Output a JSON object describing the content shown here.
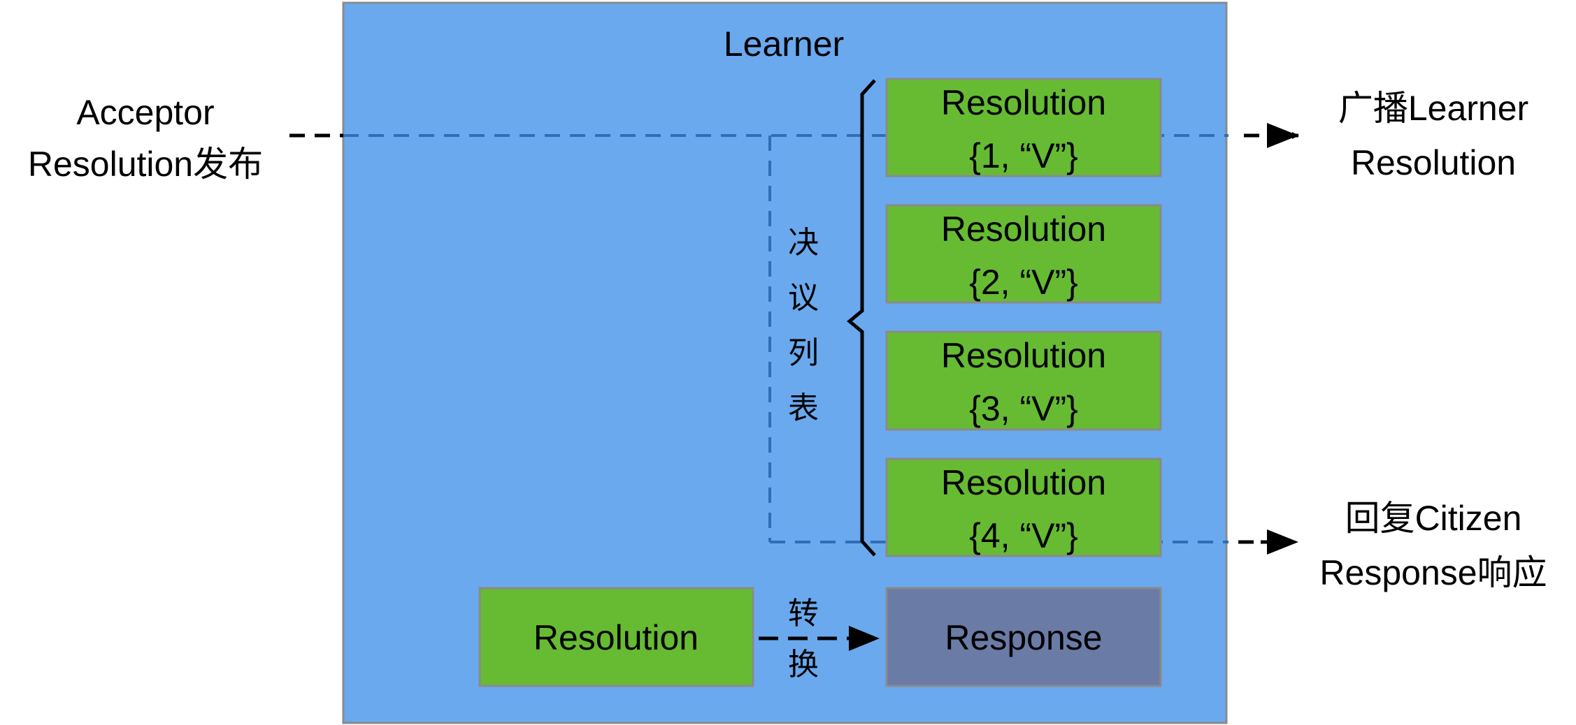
{
  "colors": {
    "learner_bg": "#6AA9EE",
    "resolution_bg": "#66BB33",
    "response_bg": "#6A7BA5",
    "dashed_line": "#2F6DB5",
    "border": "#8A8A8A"
  },
  "learner": {
    "title": "Learner"
  },
  "left_input": {
    "line1": "Acceptor",
    "line2": "Resolution发布"
  },
  "right_top_output": {
    "line1": "广播Learner",
    "line2": "Resolution"
  },
  "right_bottom_output": {
    "line1": "回复Citizen",
    "line2": "Response响应"
  },
  "resolution_list": {
    "label_chars": [
      "决",
      "议",
      "列",
      "表"
    ],
    "items": [
      {
        "title": "Resolution",
        "value": "{1, “V”}"
      },
      {
        "title": "Resolution",
        "value": "{2, “V”}"
      },
      {
        "title": "Resolution",
        "value": "{3, “V”}"
      },
      {
        "title": "Resolution",
        "value": "{4, “V”}"
      }
    ]
  },
  "conversion": {
    "source": "Resolution",
    "target": "Response",
    "label_chars": [
      "转",
      "换"
    ]
  }
}
